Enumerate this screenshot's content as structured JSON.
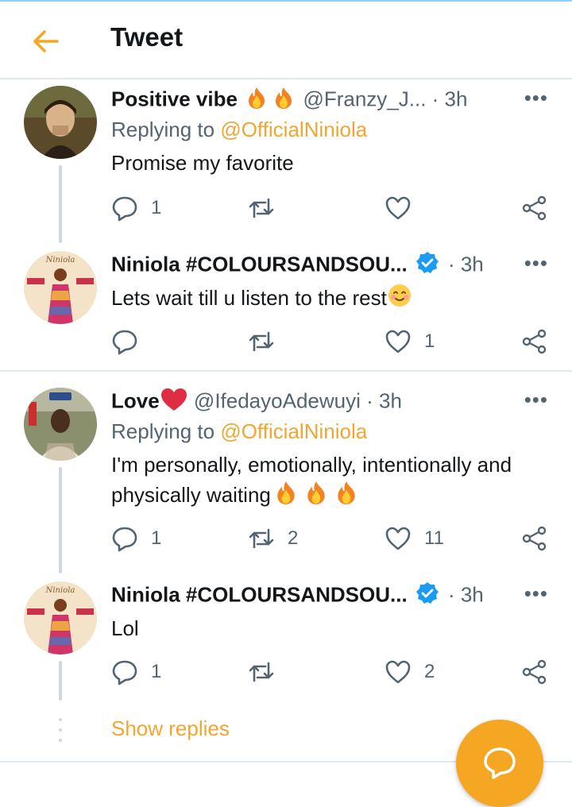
{
  "header": {
    "title": "Tweet"
  },
  "tweets": [
    {
      "name": "Positive vibe",
      "handle": "@Franzy_J...",
      "time": "· 3h",
      "more": "•••",
      "replying_prefix": "Replying to ",
      "replying_to": "@OfficialNiniola",
      "text": "Promise my favorite",
      "replies": "1",
      "retweets": "",
      "likes": ""
    },
    {
      "name": "Niniola #COLOURSANDSOU...",
      "time": "· 3h",
      "more": "•••",
      "text": "Lets wait till u listen to the rest",
      "replies": "",
      "retweets": "",
      "likes": "1"
    },
    {
      "name": "Love",
      "handle": "@IfedayoAdewuyi",
      "time": "· 3h",
      "more": "•••",
      "replying_prefix": "Replying to ",
      "replying_to": "@OfficialNiniola",
      "text_line1": "I'm personally, emotionally, intentionally and",
      "text_line2": "physically waiting",
      "replies": "1",
      "retweets": "2",
      "likes": "11"
    },
    {
      "name": "Niniola #COLOURSANDSOU...",
      "time": "· 3h",
      "more": "•••",
      "text": "Lol",
      "replies": "1",
      "retweets": "",
      "likes": "2"
    }
  ],
  "show_replies": "Show replies",
  "colors": {
    "accent": "#f5a623",
    "mention": "#f2a531",
    "verified": "#1d9bf0"
  },
  "icons": [
    "back-arrow-icon",
    "reply-icon",
    "retweet-icon",
    "like-icon",
    "share-icon",
    "verified-badge-icon",
    "fire-emoji-icon",
    "heart-emoji-icon",
    "smiling-emoji-icon",
    "compose-icon"
  ]
}
